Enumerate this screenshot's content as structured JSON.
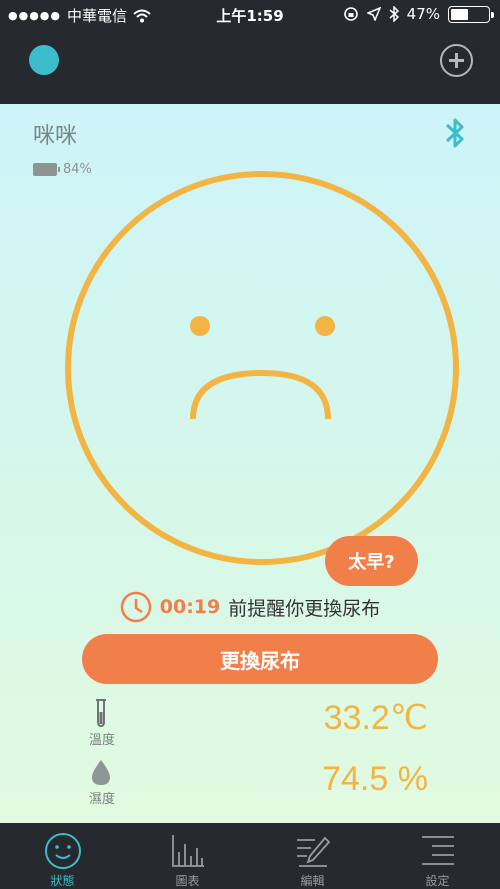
{
  "status_bar": {
    "carrier": "中華電信",
    "time": "上午1:59",
    "battery": "47%",
    "battery_level": 0.47
  },
  "device": {
    "name": "咪咪",
    "battery": "84%"
  },
  "face": {
    "mood": "sad",
    "color": "#f2b544"
  },
  "early_button": "太早?",
  "reminder": {
    "time": "00:19",
    "text": "前提醒你更換尿布"
  },
  "change_button": "更換尿布",
  "readings": [
    {
      "label": "溫度",
      "value": "33.2℃",
      "icon": "thermometer-icon"
    },
    {
      "label": "濕度",
      "value": "74.5 %",
      "icon": "water-drop-icon"
    }
  ],
  "tabs": [
    {
      "label": "狀態",
      "icon": "smiley-icon",
      "active": true
    },
    {
      "label": "圖表",
      "icon": "bar-chart-icon",
      "active": false
    },
    {
      "label": "編輯",
      "icon": "edit-icon",
      "active": false
    },
    {
      "label": "設定",
      "icon": "menu-list-icon",
      "active": false
    }
  ],
  "colors": {
    "accent": "#f07f4a",
    "teal": "#3dbdc9",
    "value": "#f2b544",
    "bar": "#262a2e"
  }
}
